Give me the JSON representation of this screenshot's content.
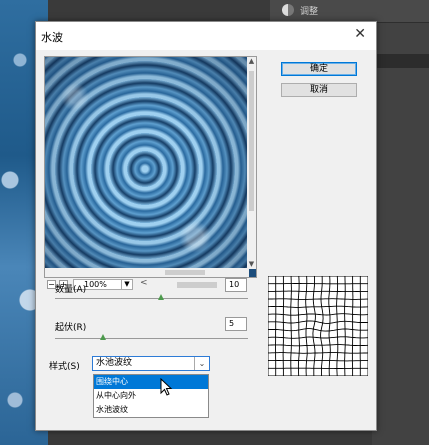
{
  "background": {
    "panel_label": "调整"
  },
  "dialog": {
    "title": "水波",
    "close_label": "✕",
    "ok_label": "确定",
    "cancel_label": "取消",
    "zoom": {
      "minus": "−",
      "plus": "+",
      "value": "100%",
      "scroll_left": "<"
    },
    "amount": {
      "label": "数量(A)",
      "value": "10",
      "slider_fraction": 0.09
    },
    "ridges": {
      "label": "起伏(R)",
      "value": "5",
      "slider_fraction": 0.2
    },
    "style": {
      "label": "样式(S)",
      "selected": "水池波纹",
      "options": [
        "围绕中心",
        "从中心向外",
        "水池波纹"
      ],
      "highlighted_index": 0
    }
  }
}
